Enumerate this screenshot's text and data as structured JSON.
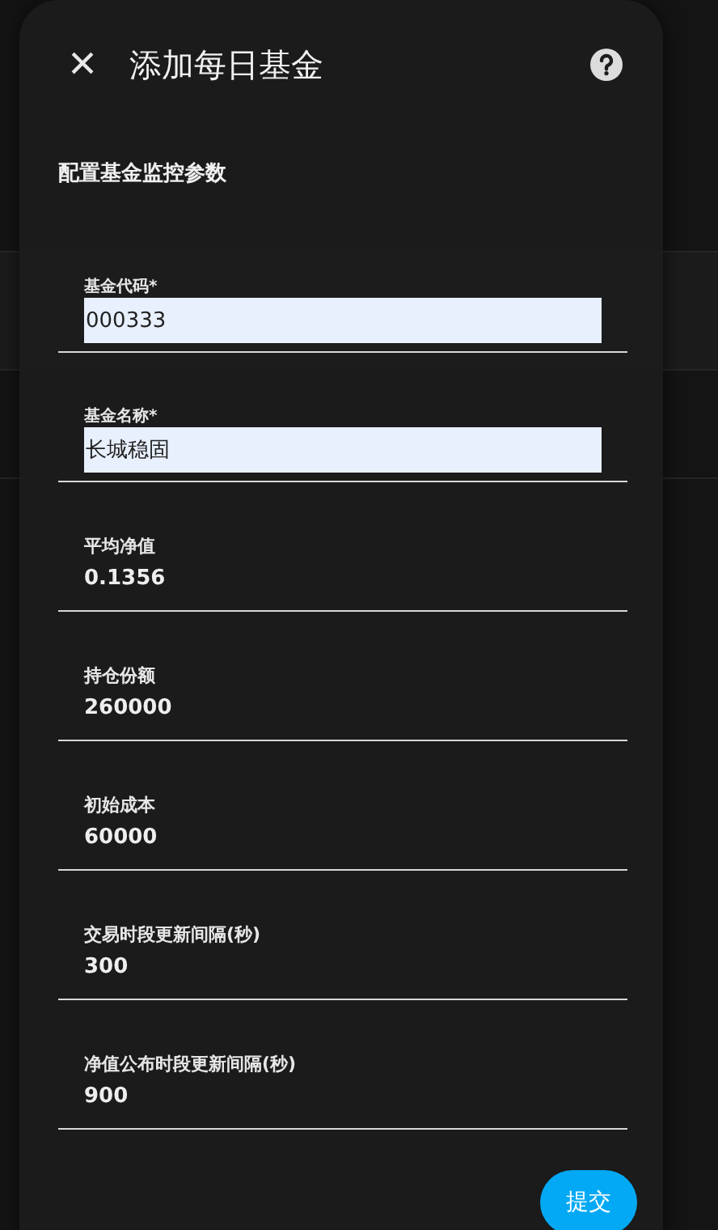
{
  "dialog": {
    "title": "添加每日基金",
    "close_glyph": "×",
    "section_title": "配置基金监控参数",
    "fields": [
      {
        "kind": "filled",
        "label": "基金代码*",
        "value": "000333"
      },
      {
        "kind": "filled",
        "label": "基金名称*",
        "value": "长城稳固"
      },
      {
        "kind": "plain",
        "label": "平均净值",
        "value": "0.1356"
      },
      {
        "kind": "plain",
        "label": "持仓份额",
        "value": "260000"
      },
      {
        "kind": "plain",
        "label": "初始成本",
        "value": "60000"
      },
      {
        "kind": "plain",
        "label": "交易时段更新间隔(秒)",
        "value": "300"
      },
      {
        "kind": "plain",
        "label": "净值公布时段更新间隔(秒)",
        "value": "900"
      }
    ],
    "submit_button": "提交"
  }
}
